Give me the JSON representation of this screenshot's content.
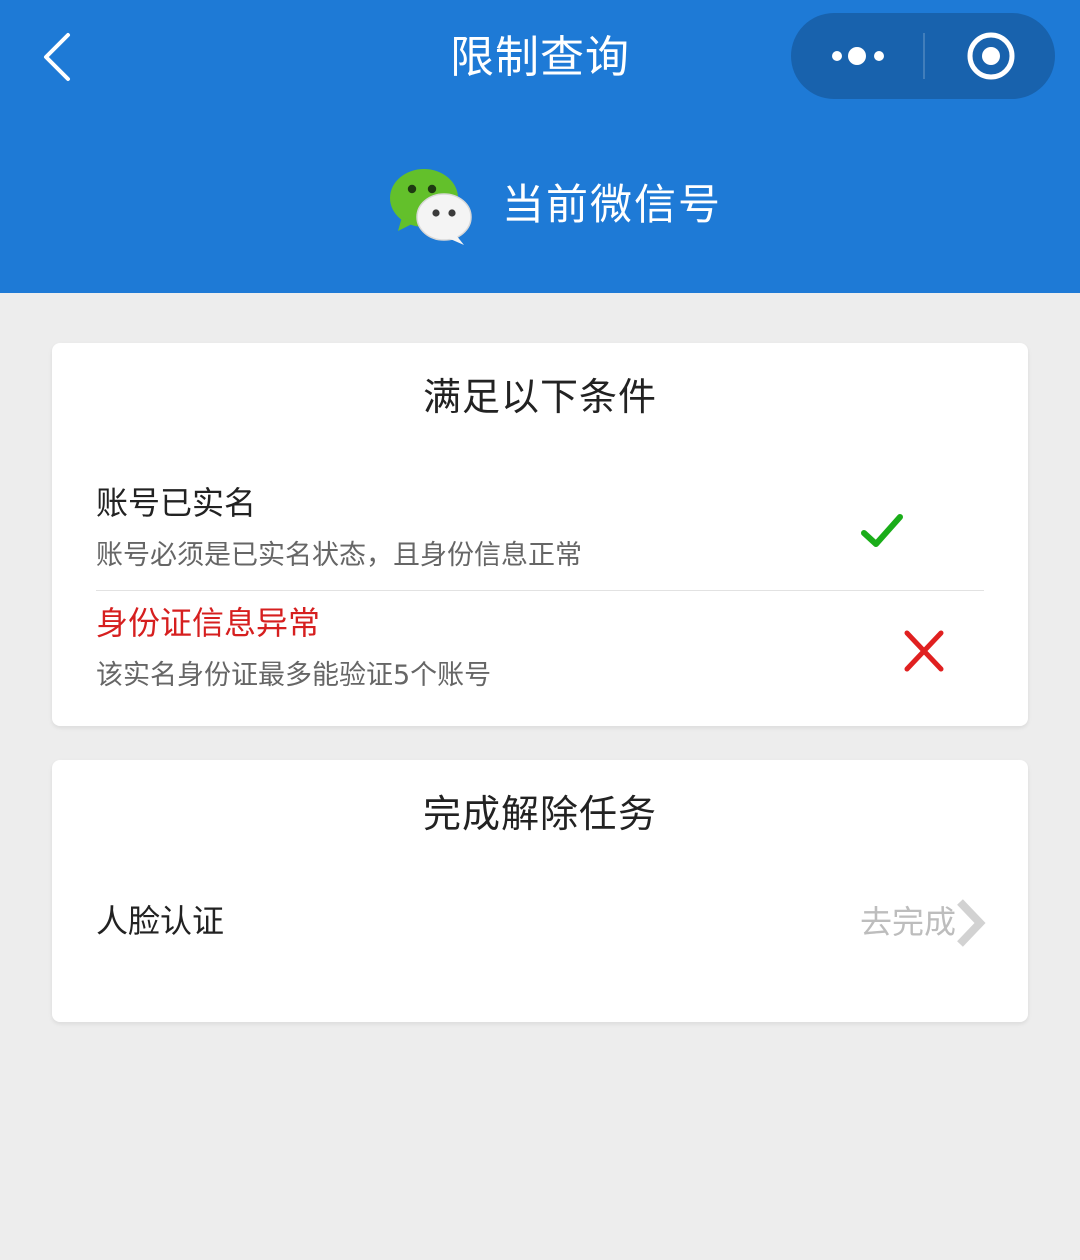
{
  "nav": {
    "title": "限制查询",
    "back_icon": "chevron-left-icon",
    "menu_icon": "more-dots-icon",
    "close_icon": "target-circle-icon"
  },
  "account": {
    "label": "当前微信号",
    "logo_icon": "wechat-logo-icon"
  },
  "conditions": {
    "title": "满足以下条件",
    "items": [
      {
        "title": "账号已实名",
        "desc": "账号必须是已实名状态，且身份信息正常",
        "status": "pass",
        "status_icon": "check-icon",
        "status_color": "#1aad19"
      },
      {
        "title": "身份证信息异常",
        "desc": "该实名身份证最多能验证5个账号",
        "status": "fail",
        "status_icon": "cross-icon",
        "status_color": "#e02020"
      }
    ]
  },
  "tasks": {
    "title": "完成解除任务",
    "items": [
      {
        "label": "人脸认证",
        "action": "去完成",
        "action_icon": "chevron-right-icon"
      }
    ]
  },
  "colors": {
    "header_bg": "#1e7ad6",
    "capsule_bg": "#1862ad",
    "page_bg": "#ededed",
    "error_text": "#d61f1f"
  }
}
